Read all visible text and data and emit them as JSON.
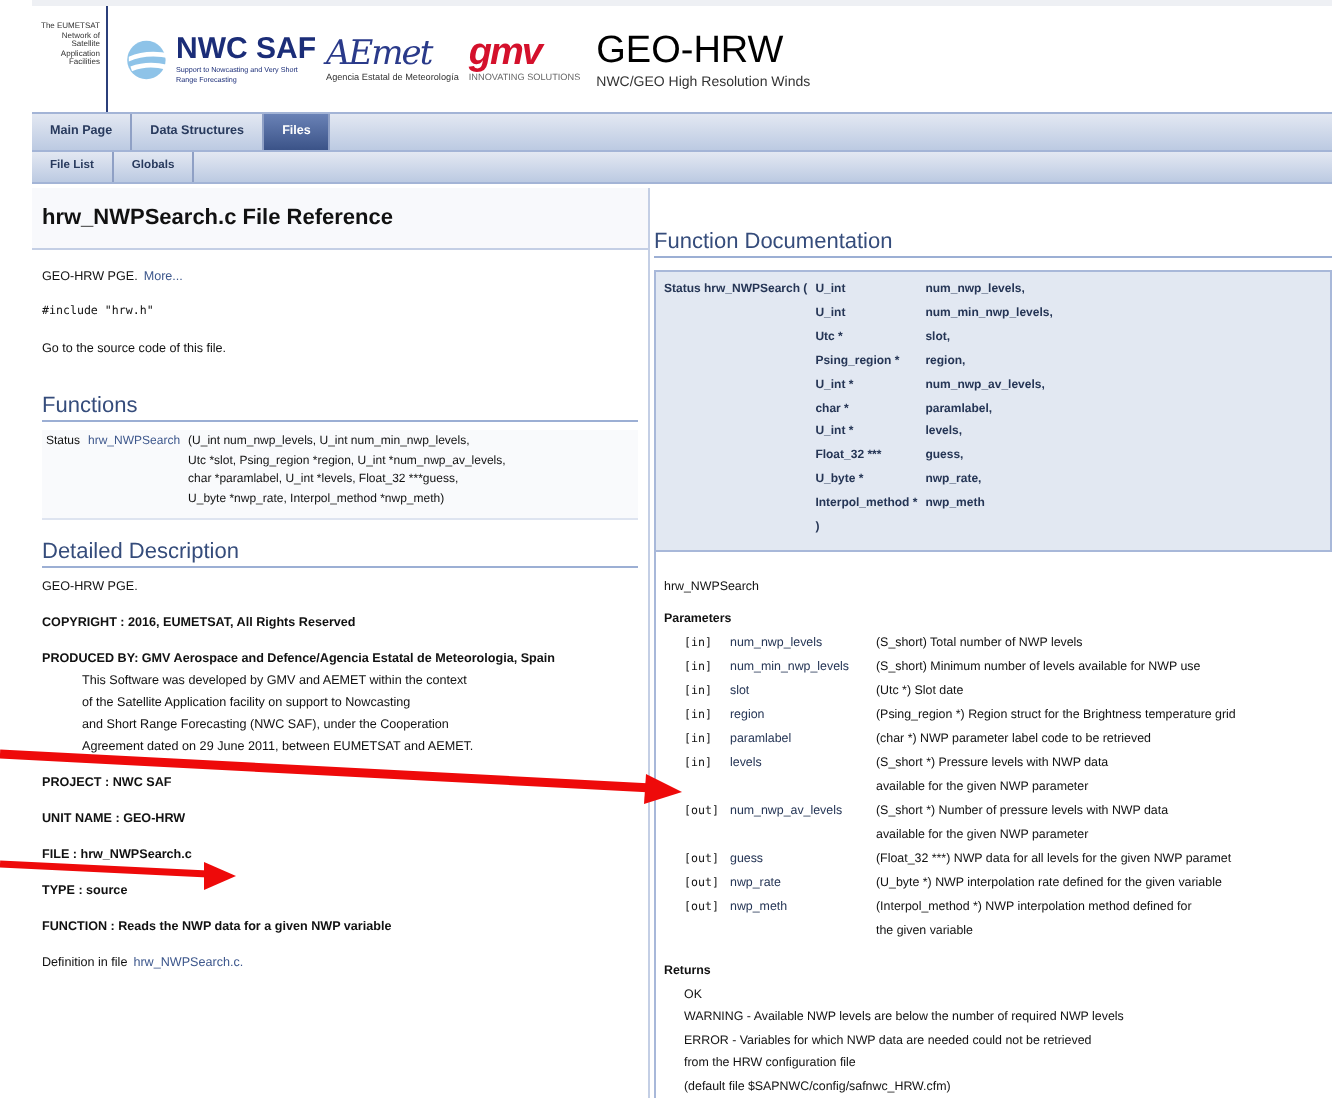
{
  "header": {
    "network_note": "The EUMETSAT Network of Satellite Application Facilities",
    "logos": [
      {
        "kind": "nwcsaf",
        "name": "NWC SAF",
        "caption": "Support to Nowcasting and Very Short Range Forecasting"
      },
      {
        "kind": "aemet",
        "name": "AEmet",
        "caption": "Agencia Estatal de Meteorología"
      },
      {
        "kind": "gmv",
        "name": "gmv",
        "caption": "INNOVATING SOLUTIONS"
      }
    ],
    "project_name": "GEO-HRW",
    "project_brief": "NWC/GEO High Resolution Winds"
  },
  "tabs": [
    {
      "label": "Main Page",
      "selected": false
    },
    {
      "label": "Data Structures",
      "selected": false
    },
    {
      "label": "Files",
      "selected": true
    }
  ],
  "subtabs": [
    {
      "label": "File List",
      "selected": false
    },
    {
      "label": "Globals",
      "selected": false
    }
  ],
  "file_reference": {
    "title": "hrw_NWPSearch.c File Reference",
    "brief": "GEO-HRW PGE.",
    "more_link": "More...",
    "include": "#include \"hrw.h\"",
    "source_link": "Go to the source code of this file.",
    "functions_heading": "Functions",
    "function_type": "Status",
    "function_name": "hrw_NWPSearch",
    "function_signature": [
      "(U_int num_nwp_levels, U_int num_min_nwp_levels,",
      "Utc *slot, Psing_region *region, U_int *num_nwp_av_levels,",
      "char *paramlabel, U_int *levels, Float_32 ***guess,",
      "U_byte *nwp_rate, Interpol_method *nwp_meth)"
    ],
    "detail_heading": "Detailed Description",
    "paragraphs": [
      {
        "kind": "plain",
        "text": "GEO-HRW PGE."
      },
      {
        "kind": "bold",
        "text": "COPYRIGHT : 2016, EUMETSAT, All Rights Reserved"
      },
      {
        "kind": "block",
        "text": "PRODUCED BY: GMV Aerospace and Defence/Agencia Estatal de Meteorologia, Spain",
        "lines": [
          "This Software was developed by GMV and AEMET within the context",
          "of the Satellite Application facility on support to Nowcasting",
          "and Short Range Forecasting (NWC SAF), under the Cooperation",
          "Agreement dated on 29 June 2011, between EUMETSAT and AEMET."
        ]
      },
      {
        "kind": "bold",
        "text": "PROJECT : NWC SAF"
      },
      {
        "kind": "bold",
        "text": "UNIT NAME : GEO-HRW"
      },
      {
        "kind": "bold",
        "text": "FILE : hrw_NWPSearch.c"
      },
      {
        "kind": "bold",
        "text": "TYPE : source"
      },
      {
        "kind": "bold",
        "text": "FUNCTION : Reads the NWP data for a given NWP variable"
      }
    ],
    "definition_text": "Definition in file",
    "definition_link": "hrw_NWPSearch.c."
  },
  "function_doc": {
    "heading": "Function Documentation",
    "return_type": "Status",
    "name": "hrw_NWPSearch (",
    "params": [
      {
        "type": "U_int",
        "name": "num_nwp_levels,"
      },
      {
        "type": "U_int",
        "name": "num_min_nwp_levels,"
      },
      {
        "type": "Utc *",
        "name": "slot,"
      },
      {
        "type": "Psing_region *",
        "name": "region,"
      },
      {
        "type": "U_int *",
        "name": "num_nwp_av_levels,"
      },
      {
        "type": "char *",
        "name": "paramlabel,"
      },
      {
        "type": "U_int *",
        "name": "levels,"
      },
      {
        "type": "Float_32 ***",
        "name": "guess,"
      },
      {
        "type": "U_byte *",
        "name": "nwp_rate,"
      },
      {
        "type": "Interpol_method *",
        "name": "nwp_meth"
      }
    ],
    "closing": ")",
    "summary": "hrw_NWPSearch",
    "parameters_heading": "Parameters",
    "parameters": [
      {
        "direction": "[in]",
        "name": "num_nwp_levels",
        "description": [
          "(S_short) Total number of NWP levels"
        ]
      },
      {
        "direction": "[in]",
        "name": "num_min_nwp_levels",
        "description": [
          "(S_short) Minimum number of levels available for NWP use"
        ]
      },
      {
        "direction": "[in]",
        "name": "slot",
        "description": [
          "(Utc *) Slot date"
        ]
      },
      {
        "direction": "[in]",
        "name": "region",
        "description": [
          "(Psing_region *) Region struct for the Brightness temperature grid"
        ]
      },
      {
        "direction": "[in]",
        "name": "paramlabel",
        "description": [
          "(char *) NWP parameter label code to be retrieved"
        ]
      },
      {
        "direction": "[in]",
        "name": "levels",
        "description": [
          "(S_short *) Pressure levels with NWP data",
          "available for the given NWP parameter"
        ]
      },
      {
        "direction": "[out]",
        "name": "num_nwp_av_levels",
        "description": [
          "(S_short *) Number of pressure levels with NWP data",
          "available for the given NWP parameter"
        ]
      },
      {
        "direction": "[out]",
        "name": "guess",
        "description": [
          "(Float_32 ***) NWP data for all levels for the given NWP paramet"
        ]
      },
      {
        "direction": "[out]",
        "name": "nwp_rate",
        "description": [
          "(U_byte *) NWP interpolation rate defined for the given variable"
        ]
      },
      {
        "direction": "[out]",
        "name": "nwp_meth",
        "description": [
          "(Interpol_method *) NWP interpolation method defined for",
          "the given variable"
        ]
      }
    ],
    "returns_heading": "Returns",
    "returns": [
      "OK",
      "WARNING - Available NWP levels are below the number of required NWP levels",
      "ERROR - Variables for which NWP data are needed could not be retrieved",
      "from the HRW configuration file",
      "(default file $SAPNWC/config/safnwc_HRW.cfm)"
    ]
  }
}
